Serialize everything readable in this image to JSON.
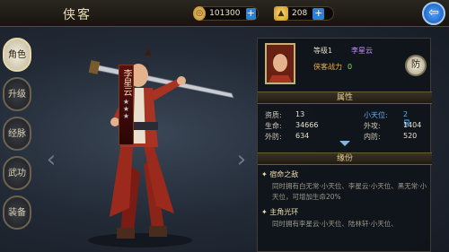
{
  "header": {
    "title": "侠客",
    "back_icon": "back-arrow-icon"
  },
  "resources": [
    {
      "icon": "copper-coin-icon",
      "value": "101300"
    },
    {
      "icon": "gold-ingot-icon",
      "value": "208"
    }
  ],
  "plus_label": "+",
  "tabs": [
    {
      "label": "角色",
      "active": true
    },
    {
      "label": "升级"
    },
    {
      "label": "经脉"
    },
    {
      "label": "武功"
    },
    {
      "label": "装备"
    }
  ],
  "character": {
    "name": "李星云",
    "stars_filled": 3,
    "stars_total": 3
  },
  "profile": {
    "level_label": "等级1",
    "name": "李星云",
    "power_label": "侠客战力",
    "power_value": "0",
    "defense_btn": "防"
  },
  "attributes_title": "属性",
  "attributes": [
    {
      "label": "资质:",
      "value": "13"
    },
    {
      "label": "小天位:",
      "value": "2星",
      "highlight": true
    },
    {
      "label": "生命:",
      "value": "34666"
    },
    {
      "label": "外攻:",
      "value": "1404"
    },
    {
      "label": "外防:",
      "value": "634"
    },
    {
      "label": "内防:",
      "value": "520"
    }
  ],
  "fate_title": "缘份",
  "fates": [
    {
      "title": "宿命之敌",
      "desc": "同时拥有白无常·小天位、李星云·小天位、黑无常·小天位，可增加生命20%"
    },
    {
      "title": "主角光环",
      "desc": "同时拥有李星云·小天位、陆林轩·小天位、"
    }
  ],
  "colors": {
    "accent": "#2e7fd6",
    "gold": "#e7cf93",
    "purple": "#c48bff",
    "blue_stat": "#54b2ff"
  }
}
